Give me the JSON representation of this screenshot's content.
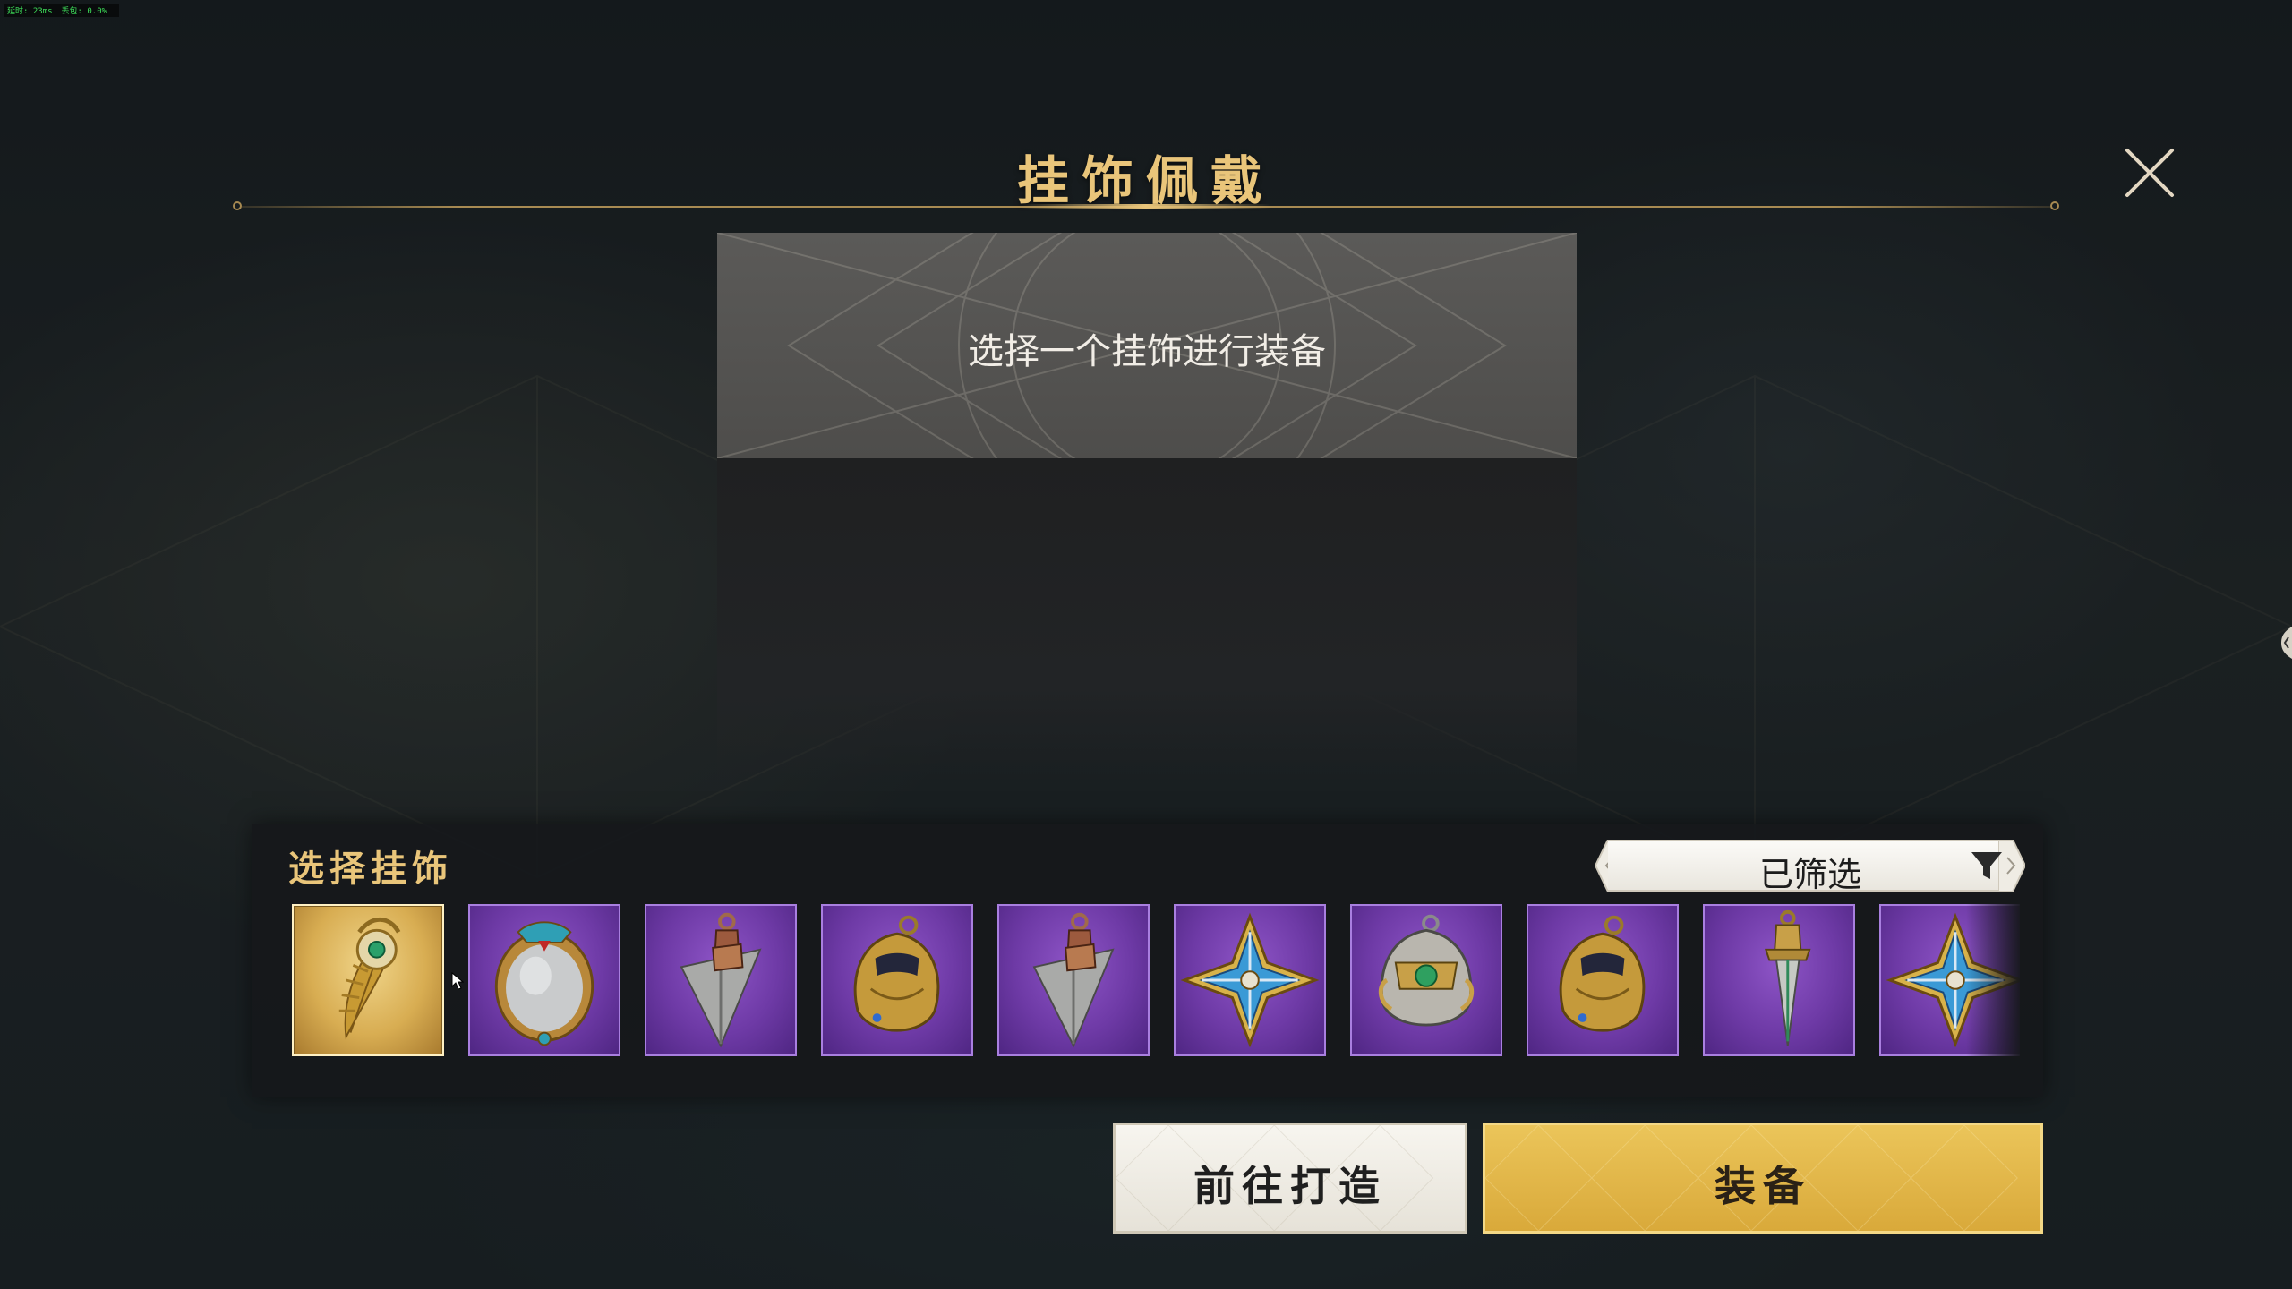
{
  "perf": {
    "latency": "延时: 23ms",
    "loss": "丢包: 0.0%"
  },
  "dialog": {
    "title": "挂饰佩戴",
    "close_icon": "close-icon"
  },
  "preview": {
    "message": "选择一个挂饰进行装备"
  },
  "selector": {
    "label": "选择挂饰",
    "filter_label": "已筛选",
    "filter_icon": "funnel-icon",
    "items": [
      {
        "name": "golden-feather-pendant",
        "rarity": "gold",
        "selected": true
      },
      {
        "name": "silver-mirror-pendant",
        "rarity": "purple",
        "selected": false
      },
      {
        "name": "arrowhead-pendant",
        "rarity": "purple",
        "selected": false
      },
      {
        "name": "golden-bell-pendant",
        "rarity": "purple",
        "selected": false
      },
      {
        "name": "arrowhead-pendant",
        "rarity": "purple",
        "selected": false
      },
      {
        "name": "blue-star-pendant",
        "rarity": "purple",
        "selected": false
      },
      {
        "name": "silver-shield-pendant",
        "rarity": "purple",
        "selected": false
      },
      {
        "name": "golden-bell-pendant",
        "rarity": "purple",
        "selected": false
      },
      {
        "name": "dagger-pendant",
        "rarity": "purple",
        "selected": false
      },
      {
        "name": "blue-star-pendant",
        "rarity": "purple",
        "selected": false
      }
    ]
  },
  "actions": {
    "forge_label": "前往打造",
    "equip_label": "装备"
  },
  "colors": {
    "title_gold": "#e9c57a",
    "equip_button": "#e1b548",
    "purple_rarity": "#6e3aa6",
    "gold_rarity": "#d8ad52"
  }
}
